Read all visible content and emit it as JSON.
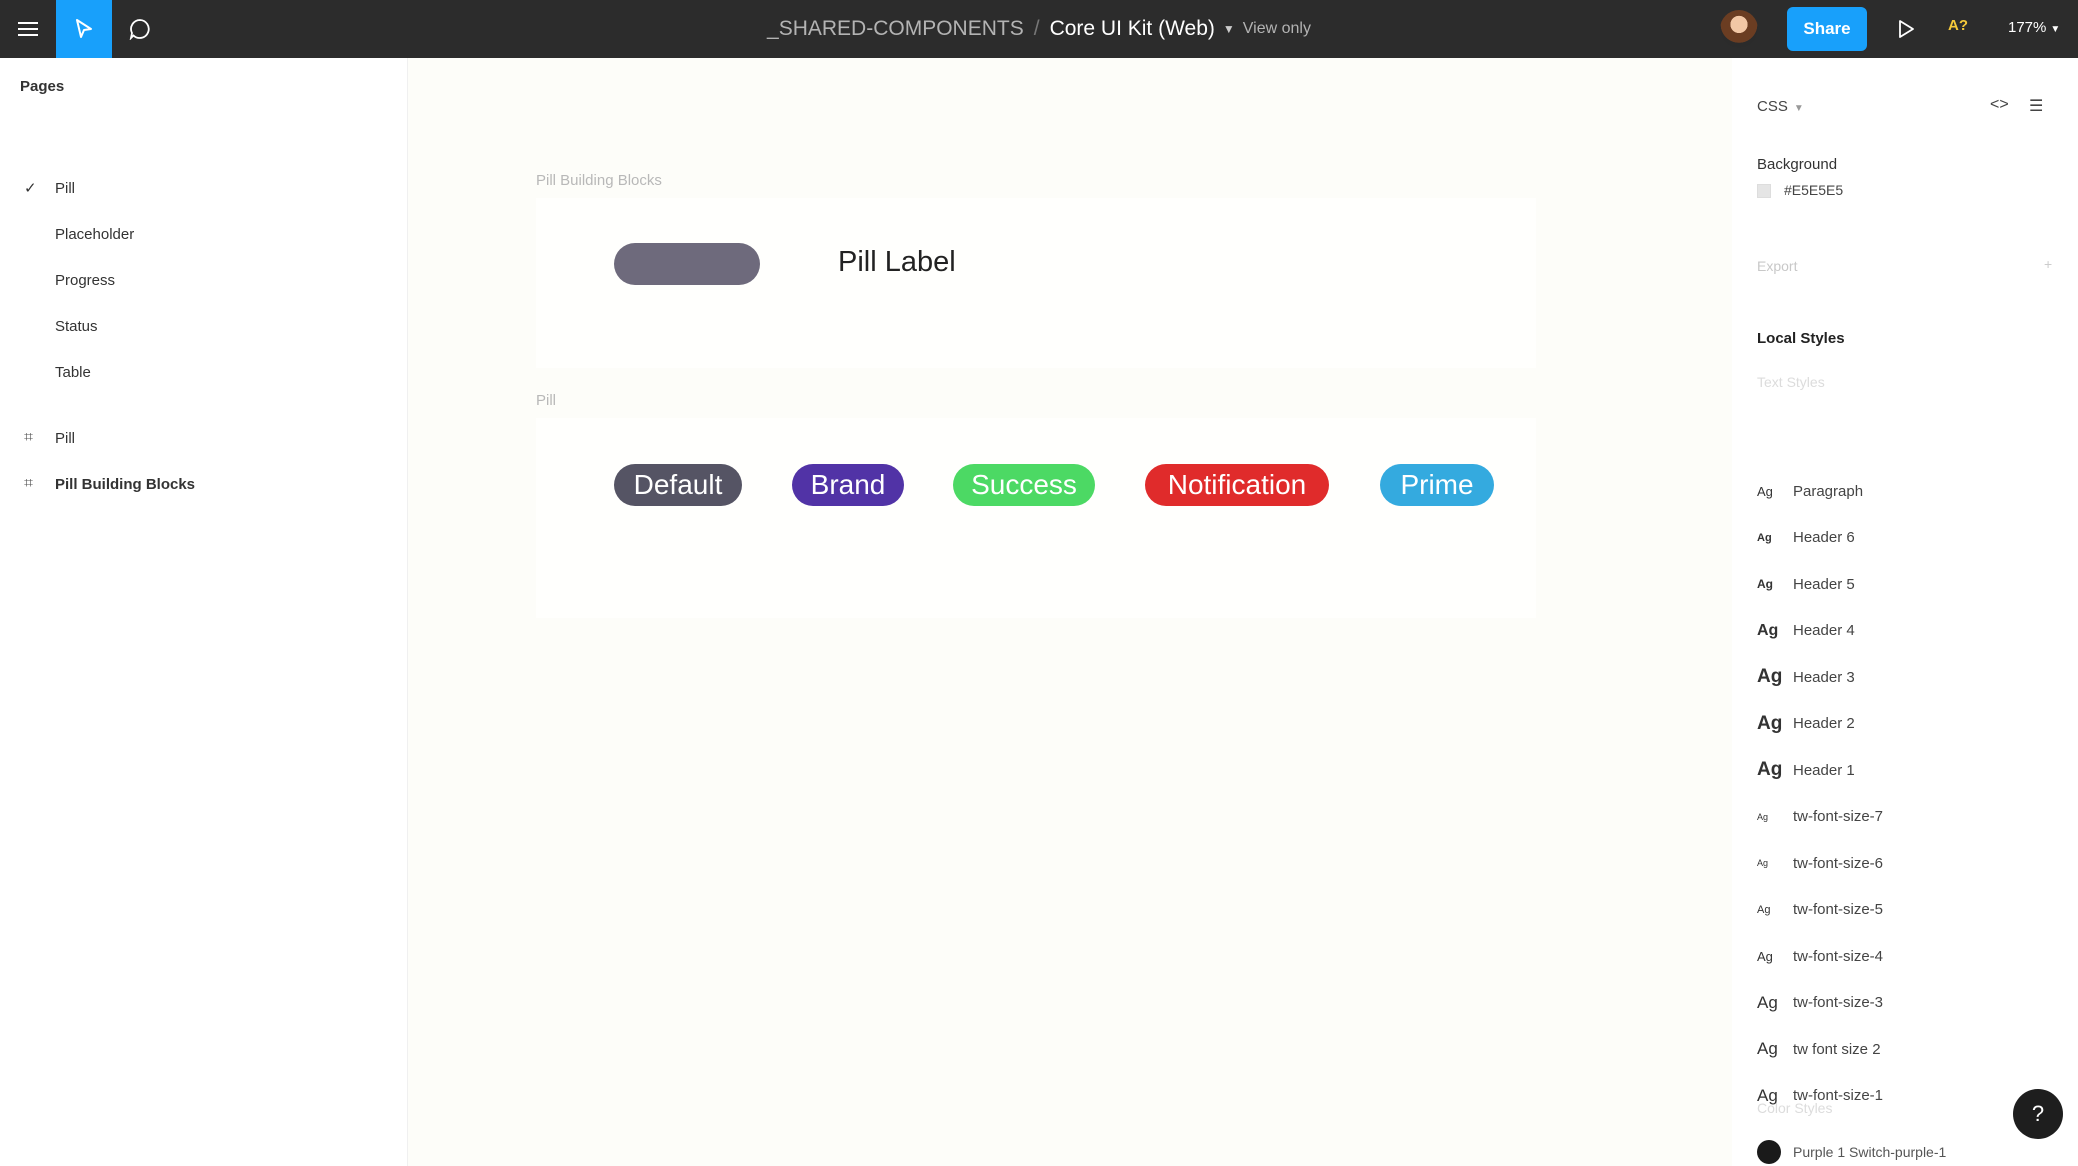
{
  "topbar": {
    "project": "_SHARED-COMPONENTS",
    "separator": "/",
    "file": "Core UI Kit (Web)",
    "mode": "View only",
    "share": "Share",
    "ai": "A?",
    "zoom": "177%"
  },
  "sidebar": {
    "pages_title": "Pages",
    "pages": [
      {
        "label": "Pill",
        "checked": true
      },
      {
        "label": "Placeholder"
      },
      {
        "label": "Progress"
      },
      {
        "label": "Status"
      },
      {
        "label": "Table"
      }
    ],
    "layers": [
      {
        "label": "Pill"
      },
      {
        "label": "Pill Building Blocks"
      }
    ]
  },
  "canvas": {
    "frame1_title": "Pill Building Blocks",
    "pill_label": "Pill Label",
    "frame2_title": "Pill",
    "pills": [
      {
        "label": "Default",
        "color": "#555464"
      },
      {
        "label": "Brand",
        "color": "#5133a6"
      },
      {
        "label": "Success",
        "color": "#4cd964"
      },
      {
        "label": "Notification",
        "color": "#e02b2b"
      },
      {
        "label": "Prime",
        "color": "#34aadf"
      }
    ]
  },
  "inspector": {
    "css": "CSS",
    "background_title": "Background",
    "background_value": "#E5E5E5",
    "export": "Export",
    "local_styles": "Local Styles",
    "text_styles": "Text Styles",
    "ag": "Ag",
    "styles": [
      "Paragraph",
      "Header 6",
      "Header 5",
      "Header 4",
      "Header 3",
      "Header 2",
      "Header 1",
      "tw-font-size-7",
      "tw-font-size-6",
      "tw-font-size-5",
      "tw-font-size-4",
      "tw-font-size-3",
      "tw font size 2",
      "tw-font-size-1"
    ],
    "color_styles": "Color Styles",
    "color_item": "Purple 1 Switch-purple-1"
  },
  "help": "?"
}
